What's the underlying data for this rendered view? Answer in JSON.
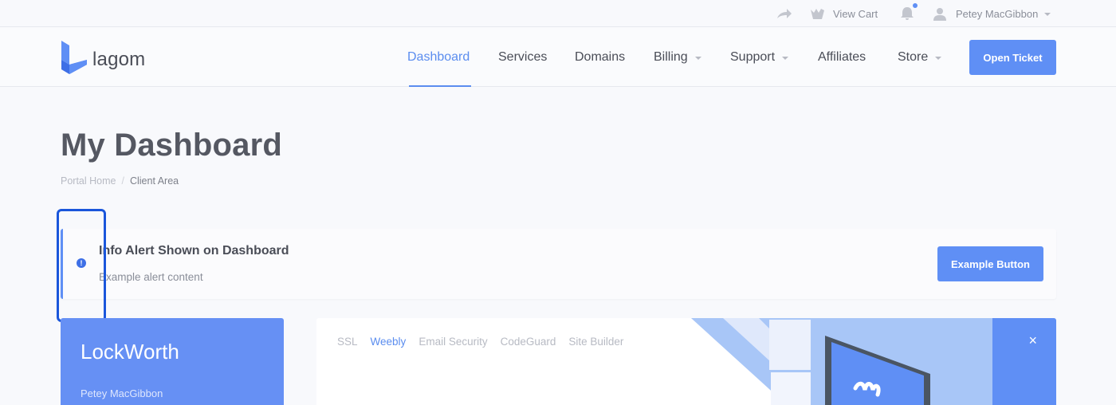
{
  "topbar": {
    "share_icon": "share-arrow-icon",
    "cart_label": "View Cart",
    "cart_icon": "basket-icon",
    "notification_icon": "bell-icon",
    "user_name": "Petey MacGibbon",
    "user_icon": "user-icon"
  },
  "brand": {
    "name": "lagom",
    "logo_icon": "lagom-logo-icon"
  },
  "nav": {
    "items": [
      {
        "label": "Dashboard",
        "active": true,
        "has_dropdown": false
      },
      {
        "label": "Services",
        "active": false,
        "has_dropdown": false
      },
      {
        "label": "Domains",
        "active": false,
        "has_dropdown": false
      },
      {
        "label": "Billing",
        "active": false,
        "has_dropdown": true
      },
      {
        "label": "Support",
        "active": false,
        "has_dropdown": true
      },
      {
        "label": "Affiliates",
        "active": false,
        "has_dropdown": false
      },
      {
        "label": "Store",
        "active": false,
        "has_dropdown": true
      }
    ],
    "cta_label": "Open Ticket"
  },
  "page": {
    "title": "My Dashboard",
    "breadcrumb": [
      {
        "label": "Portal Home",
        "separator": "/"
      },
      {
        "label": "Client Area"
      }
    ]
  },
  "alert": {
    "title": "Info Alert Shown on Dashboard",
    "body": "Example alert content",
    "button_label": "Example Button",
    "icon": "info-circle-icon"
  },
  "client": {
    "company": "LockWorth",
    "name": "Petey MacGibbon"
  },
  "promo": {
    "tabs": [
      {
        "label": "SSL",
        "active": false
      },
      {
        "label": "Weebly",
        "active": true
      },
      {
        "label": "Email Security",
        "active": false
      },
      {
        "label": "CodeGuard",
        "active": false
      },
      {
        "label": "Site Builder",
        "active": false
      }
    ],
    "close_glyph": "×"
  },
  "colors": {
    "accent": "#5f8ff5",
    "page_bg": "#f8f9fc",
    "client_card": "#6690f4",
    "highlight": "#1a56db"
  }
}
